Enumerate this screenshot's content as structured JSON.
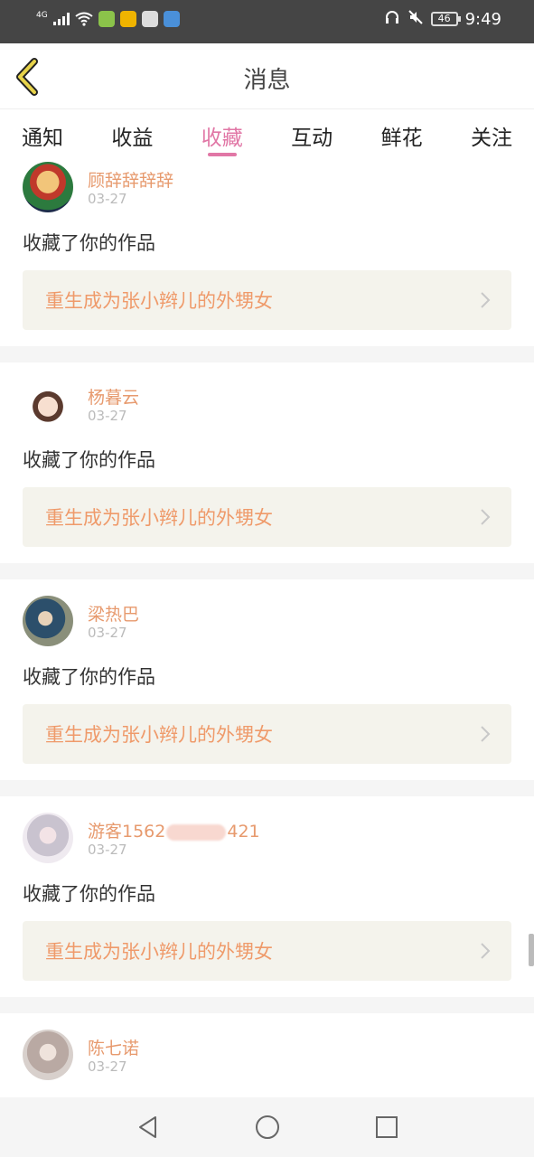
{
  "status_bar": {
    "network": "4G",
    "battery": "46",
    "time": "9:49"
  },
  "header": {
    "title": "消息"
  },
  "tabs": [
    {
      "label": "通知"
    },
    {
      "label": "收益"
    },
    {
      "label": "收藏",
      "active": true
    },
    {
      "label": "互动"
    },
    {
      "label": "鲜花"
    },
    {
      "label": "关注"
    }
  ],
  "messages": [
    {
      "user": "顾辞辞辞辞",
      "date": "03-27",
      "action": "收藏了你的作品",
      "work": "重生成为张小辫儿的外甥女"
    },
    {
      "user": "杨暮云",
      "date": "03-27",
      "action": "收藏了你的作品",
      "work": "重生成为张小辫儿的外甥女"
    },
    {
      "user": "梁热巴",
      "date": "03-27",
      "action": "收藏了你的作品",
      "work": "重生成为张小辫儿的外甥女"
    },
    {
      "user_prefix": "游客1562",
      "user_suffix": "421",
      "date": "03-27",
      "action": "收藏了你的作品",
      "work": "重生成为张小辫儿的外甥女"
    },
    {
      "user": "陈七诺",
      "date": "03-27"
    }
  ],
  "colors": {
    "accent": "#e177a6",
    "username": "#e79a6e",
    "work_title": "#ef9a6a"
  },
  "icons": [
    "back-icon",
    "chevron-right-icon",
    "nav-back-icon",
    "nav-home-icon",
    "nav-recents-icon"
  ]
}
